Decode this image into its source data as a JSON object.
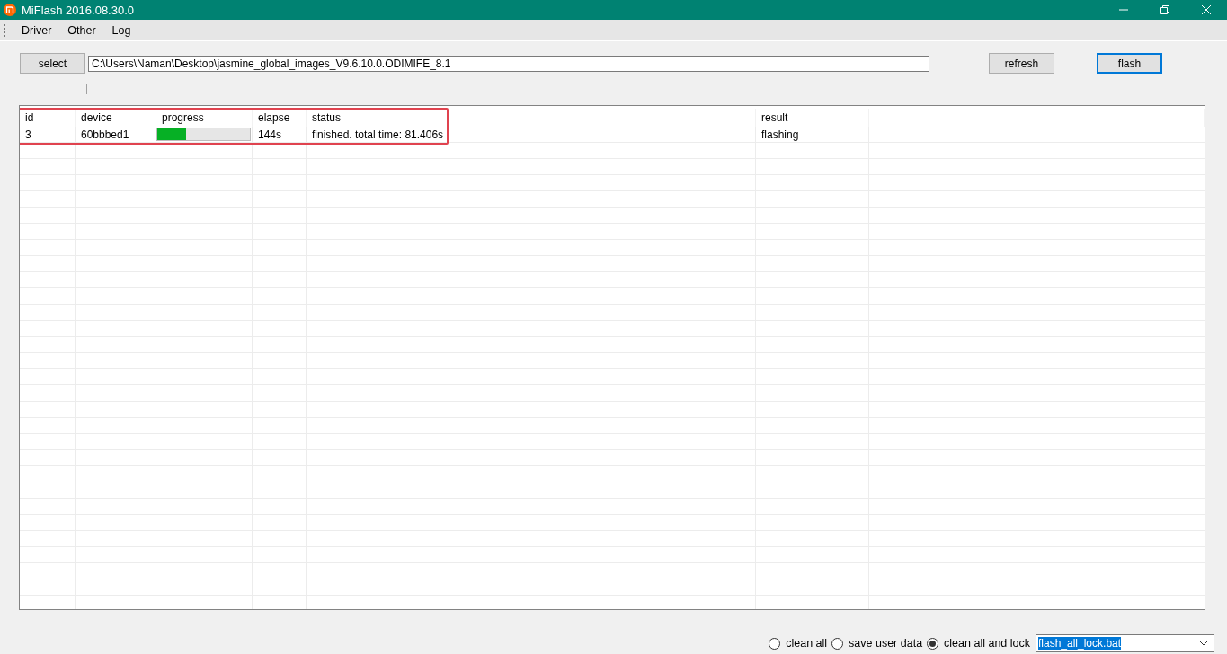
{
  "window": {
    "title": "MiFlash 2016.08.30.0"
  },
  "menu": [
    {
      "label": "Driver"
    },
    {
      "label": "Other"
    },
    {
      "label": "Log"
    }
  ],
  "path_bar": {
    "select_button": "select",
    "path": "C:\\Users\\Naman\\Desktop\\jasmine_global_images_V9.6.10.0.ODIMIFE_8.1"
  },
  "buttons": [
    {
      "label": "refresh",
      "focused": false
    },
    {
      "label": "flash",
      "focused": true
    }
  ],
  "table": {
    "columns": [
      "id",
      "device",
      "progress",
      "elapse",
      "status",
      "result"
    ],
    "rows": [
      {
        "id": "3",
        "device": "60bbbed1",
        "level": 0.31,
        "elapse": "144s",
        "status": "finished. total time: 81.406s",
        "result": "flashing"
      }
    ],
    "highlighted": true
  },
  "options": [
    {
      "label": "clean all",
      "selected": false
    },
    {
      "label": "save user data",
      "selected": false
    },
    {
      "label": "clean all and lock",
      "selected": true
    }
  ],
  "script_combo": {
    "value": "flash_all_lock.bat",
    "text_selected": true
  }
}
